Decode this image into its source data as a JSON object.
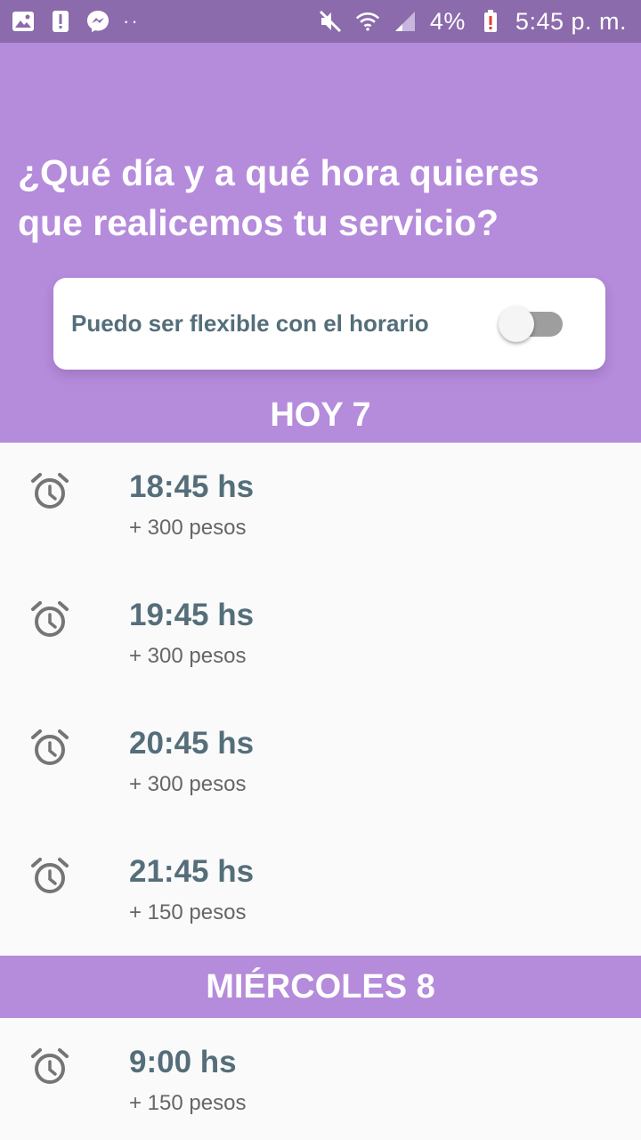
{
  "status_bar": {
    "battery": "4%",
    "time": "5:45 p. m.",
    "icons_left": [
      "image-icon",
      "alert-icon",
      "messenger-icon",
      "more-dots-icon"
    ],
    "icons_right": [
      "mute-icon",
      "wifi-icon",
      "signal-icon",
      "battery-low-icon"
    ]
  },
  "header": {
    "title_line1": "¿Qué día y a qué hora quieres",
    "title_line2": "que realicemos tu servicio?",
    "flexible_label": "Puedo ser flexible con el horario",
    "flexible_on": false
  },
  "colors": {
    "header_bg": "#b58bdb",
    "status_bar_bg": "#8b6bab",
    "time_text": "#546e7a",
    "list_bg": "#fafafa"
  },
  "days": [
    {
      "label": "HOY 7",
      "slots": [
        {
          "time": "18:45 hs",
          "price": "+ 300 pesos",
          "icon": "alarm-clock-icon"
        },
        {
          "time": "19:45 hs",
          "price": "+ 300 pesos",
          "icon": "alarm-clock-icon"
        },
        {
          "time": "20:45 hs",
          "price": "+ 300 pesos",
          "icon": "alarm-clock-icon"
        },
        {
          "time": "21:45 hs",
          "price": "+ 150 pesos",
          "icon": "alarm-clock-icon"
        }
      ]
    },
    {
      "label": "MIÉRCOLES 8",
      "slots": [
        {
          "time": "9:00 hs",
          "price": "+ 150 pesos",
          "icon": "alarm-clock-icon"
        }
      ]
    }
  ]
}
